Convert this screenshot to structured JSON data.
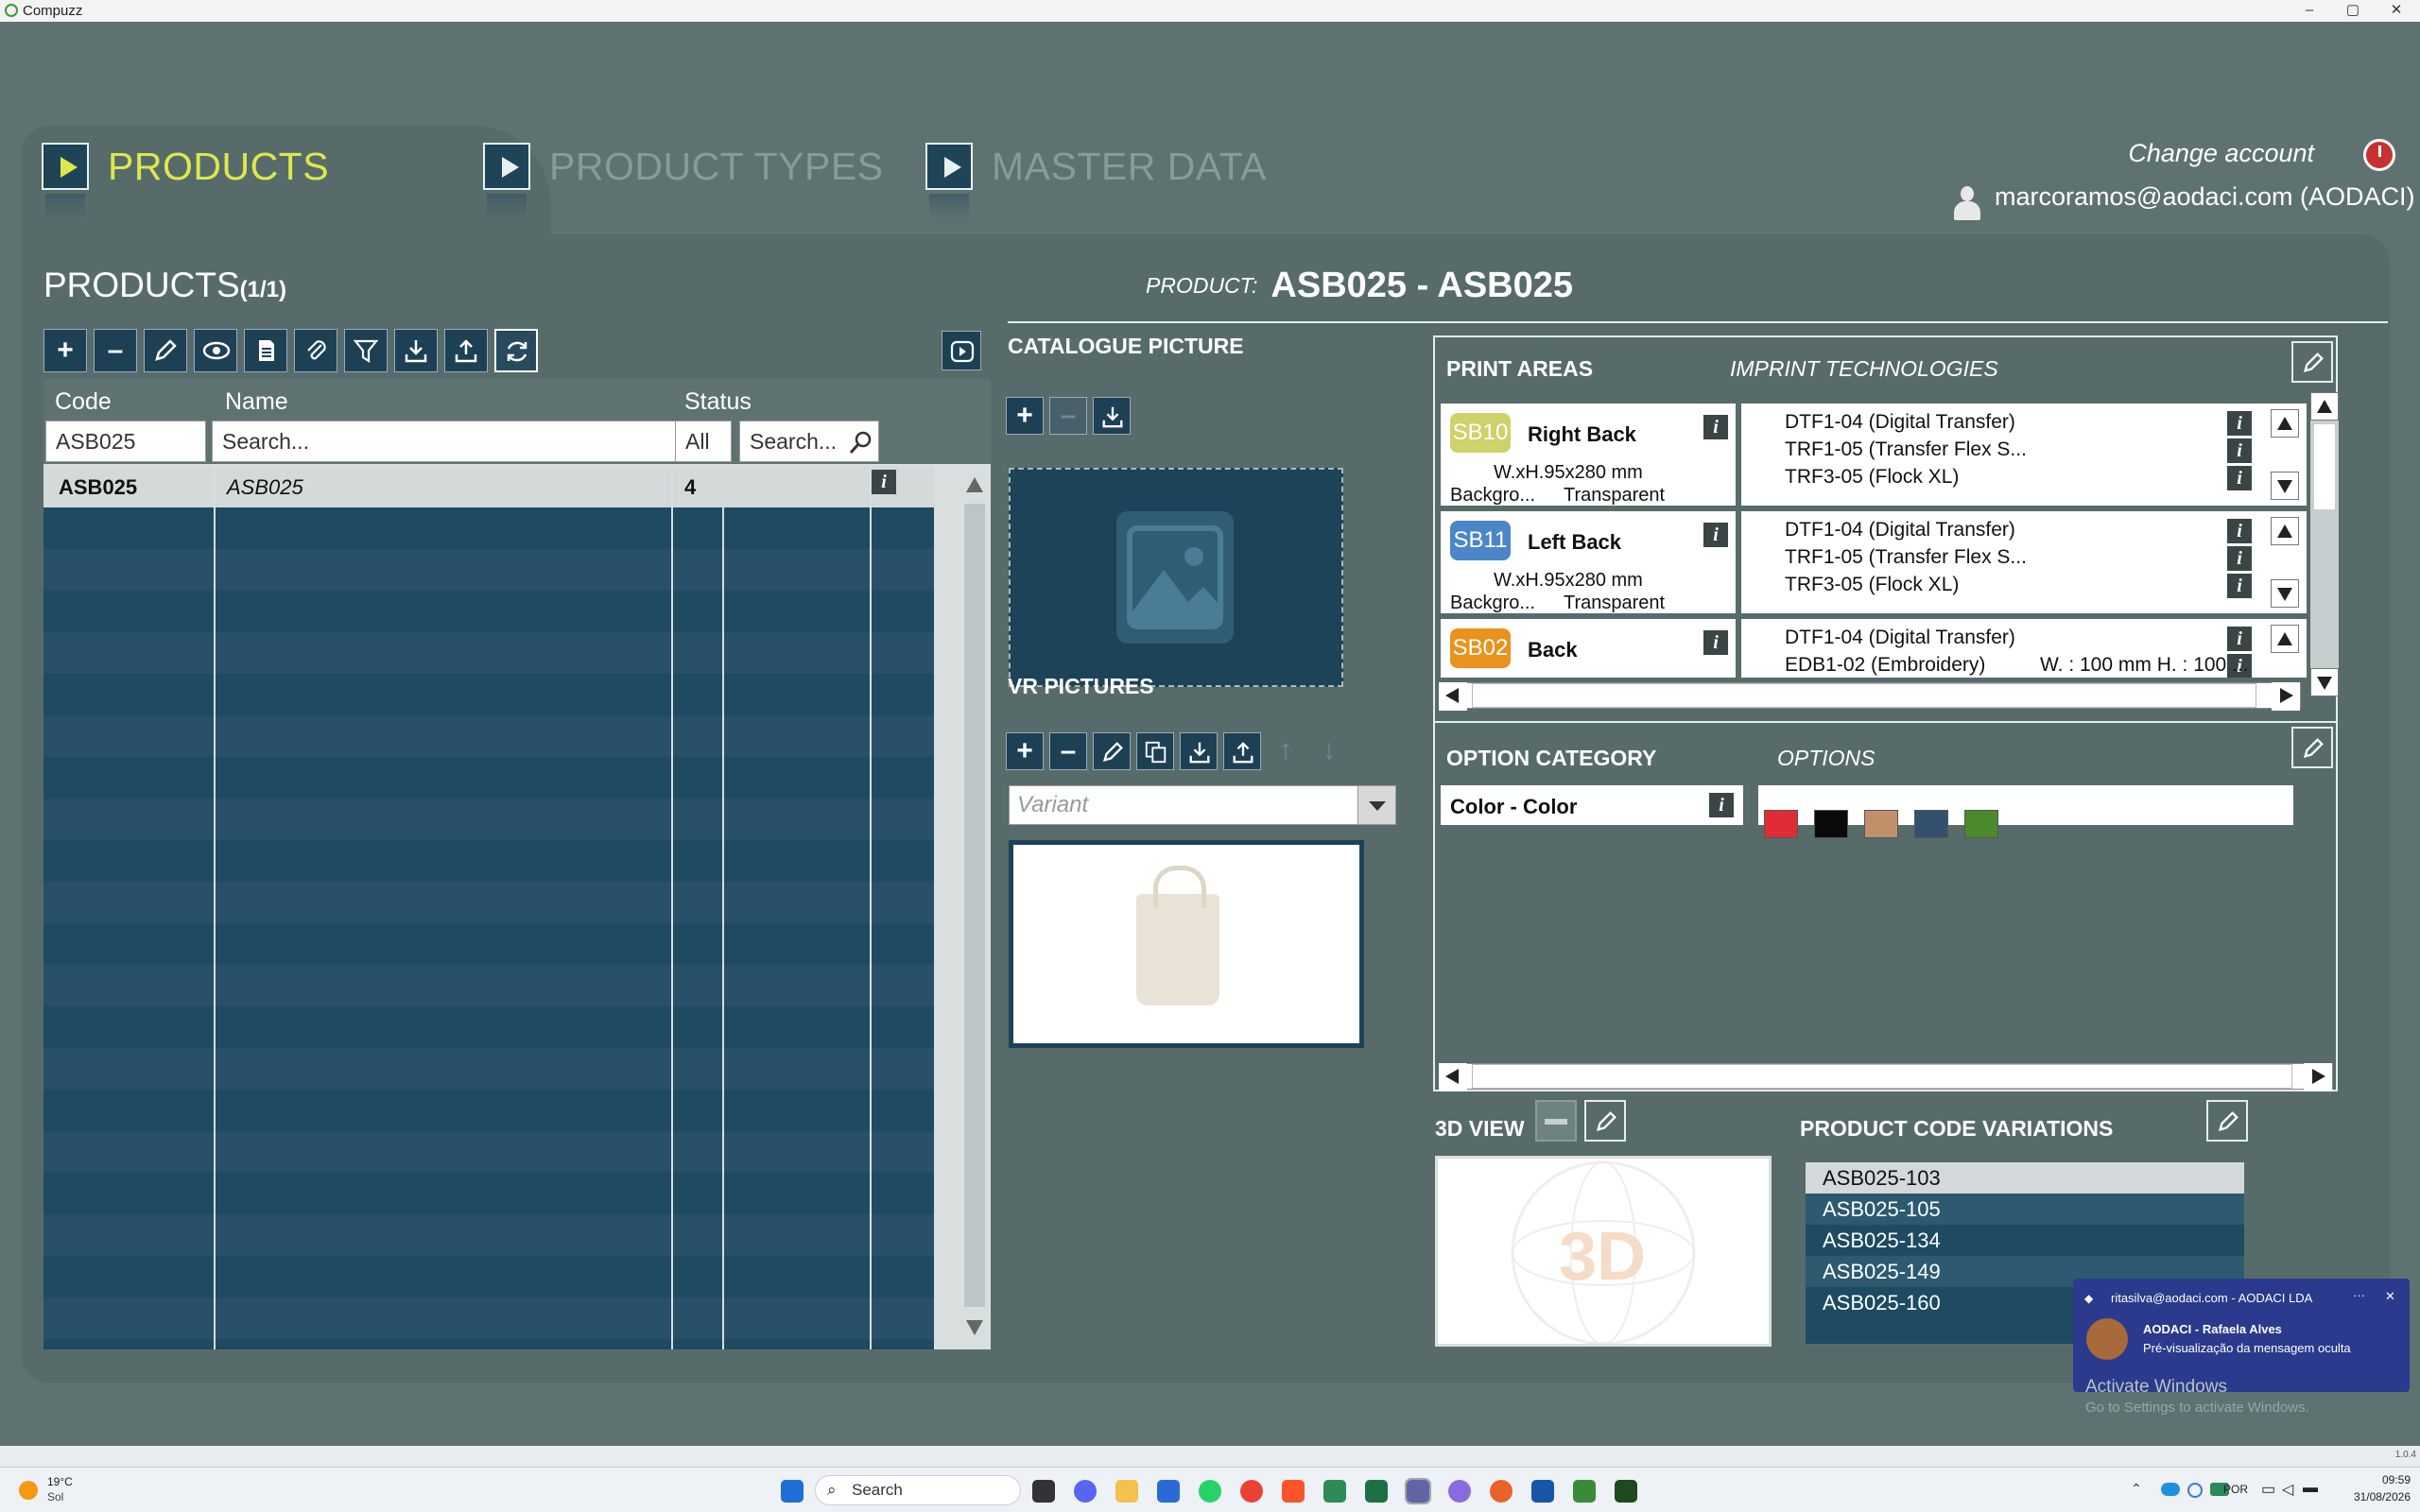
{
  "window": {
    "title": "Compuzz"
  },
  "tabs": [
    {
      "label": "PRODUCTS",
      "active": true
    },
    {
      "label": "PRODUCT TYPES",
      "active": false
    },
    {
      "label": "MASTER DATA",
      "active": false
    }
  ],
  "account": {
    "change_label": "Change account",
    "user": "marcoramos@aodaci.com (AODACI)"
  },
  "products": {
    "title": "PRODUCTS",
    "count": "(1/1)",
    "columns": {
      "code": "Code",
      "name": "Name",
      "status": "Status"
    },
    "filters": {
      "code": "ASB025",
      "name_placeholder": "Search...",
      "status": "All",
      "status_search": "Search..."
    },
    "rows": [
      {
        "code": "ASB025",
        "name": "ASB025",
        "status": "4"
      }
    ]
  },
  "product": {
    "label": "PRODUCT:",
    "value": "ASB025 - ASB025"
  },
  "catalogue": {
    "title": "CATALOGUE PICTURE"
  },
  "vr": {
    "title": "VR PICTURES",
    "variant_placeholder": "Variant"
  },
  "print_areas": {
    "title": "PRINT AREAS",
    "tech_title": "IMPRINT TECHNOLOGIES",
    "items": [
      {
        "code": "SB10",
        "color": "#cfd16a",
        "name": "Right Back",
        "dim": "W.xH.95x280 mm",
        "bg_label": "Backgro...",
        "bg_value": "Transparent",
        "techs": [
          "DTF1-04 (Digital Transfer)",
          "TRF1-05 (Transfer Flex S...",
          "TRF3-05 (Flock XL)"
        ]
      },
      {
        "code": "SB11",
        "color": "#4b86c9",
        "name": "Left Back",
        "dim": "W.xH.95x280 mm",
        "bg_label": "Backgro...",
        "bg_value": "Transparent",
        "techs": [
          "DTF1-04 (Digital Transfer)",
          "TRF1-05 (Transfer Flex S...",
          "TRF3-05 (Flock XL)"
        ]
      },
      {
        "code": "SB02",
        "color": "#e9921e",
        "name": "Back",
        "dim": "",
        "bg_label": "",
        "bg_value": "",
        "techs": [
          "DTF1-04 (Digital Transfer)",
          "EDB1-02 (Embroidery)"
        ],
        "extra": "W. : 100 mm H. : 100 ..."
      }
    ]
  },
  "options": {
    "title": "OPTION CATEGORY",
    "options_title": "OPTIONS",
    "category": "Color - Color",
    "swatches": [
      "#e02b35",
      "#0a0a0a",
      "#c0906a",
      "#34506e",
      "#4a8a2a"
    ]
  },
  "view3d": {
    "title": "3D VIEW"
  },
  "pcv": {
    "title": "PRODUCT CODE VARIATIONS",
    "items": [
      "ASB025-103",
      "ASB025-105",
      "ASB025-134",
      "ASB025-149",
      "ASB025-160"
    ]
  },
  "notification": {
    "account": "ritasilva@aodaci.com - AODACI LDA",
    "title": "AODACI - Rafaela Alves",
    "body": "Pré-visualização da mensagem oculta"
  },
  "activate": {
    "title": "Activate Windows",
    "sub": "Go to Settings to activate Windows."
  },
  "version": "1.0.4",
  "taskbar": {
    "weather_temp": "19°C",
    "weather_desc": "Sol",
    "search": "Search",
    "lang": "POR",
    "time": "09:59",
    "date": "31/08/2026"
  }
}
